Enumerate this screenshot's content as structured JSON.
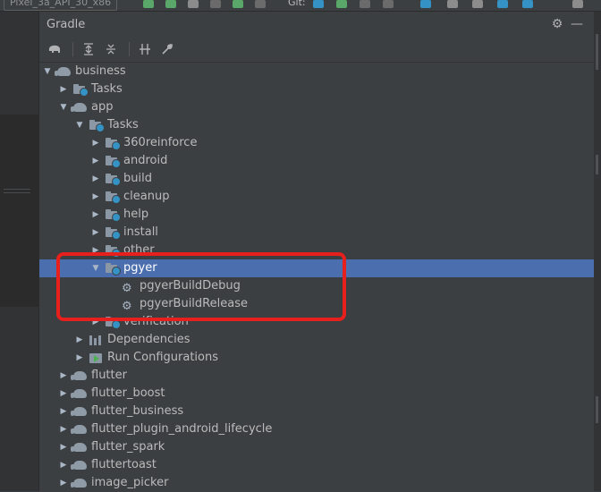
{
  "topbar": {
    "device": "Pixel_3a_API_30_x86",
    "git_label": "Git:"
  },
  "panel": {
    "title": "Gradle"
  },
  "toolbar": {
    "buttons": [
      "elephant-icon",
      "expand-all-icon",
      "collapse-all-icon",
      "toggle-offline-icon",
      "settings-wrench-icon"
    ]
  },
  "tree": [
    {
      "label": "business",
      "depth": 0,
      "expanded": true,
      "icon": "elephant"
    },
    {
      "label": "Tasks",
      "depth": 1,
      "expanded": false,
      "icon": "folder"
    },
    {
      "label": "app",
      "depth": 1,
      "expanded": true,
      "icon": "elephant"
    },
    {
      "label": "Tasks",
      "depth": 2,
      "expanded": true,
      "icon": "folder"
    },
    {
      "label": "360reinforce",
      "depth": 3,
      "expanded": false,
      "icon": "folder"
    },
    {
      "label": "android",
      "depth": 3,
      "expanded": false,
      "icon": "folder"
    },
    {
      "label": "build",
      "depth": 3,
      "expanded": false,
      "icon": "folder"
    },
    {
      "label": "cleanup",
      "depth": 3,
      "expanded": false,
      "icon": "folder"
    },
    {
      "label": "help",
      "depth": 3,
      "expanded": false,
      "icon": "folder"
    },
    {
      "label": "install",
      "depth": 3,
      "expanded": false,
      "icon": "folder"
    },
    {
      "label": "other",
      "depth": 3,
      "expanded": false,
      "icon": "folder"
    },
    {
      "label": "pgyer",
      "depth": 3,
      "expanded": true,
      "icon": "folder",
      "selected": true
    },
    {
      "label": "pgyerBuildDebug",
      "depth": 4,
      "leaf": true,
      "icon": "gear"
    },
    {
      "label": "pgyerBuildRelease",
      "depth": 4,
      "leaf": true,
      "icon": "gear"
    },
    {
      "label": "verification",
      "depth": 3,
      "expanded": false,
      "icon": "folder"
    },
    {
      "label": "Dependencies",
      "depth": 2,
      "expanded": false,
      "icon": "deps"
    },
    {
      "label": "Run Configurations",
      "depth": 2,
      "expanded": false,
      "icon": "runcfg"
    },
    {
      "label": "flutter",
      "depth": 1,
      "expanded": false,
      "icon": "elephant"
    },
    {
      "label": "flutter_boost",
      "depth": 1,
      "expanded": false,
      "icon": "elephant"
    },
    {
      "label": "flutter_business",
      "depth": 1,
      "expanded": false,
      "icon": "elephant"
    },
    {
      "label": "flutter_plugin_android_lifecycle",
      "depth": 1,
      "expanded": false,
      "icon": "elephant"
    },
    {
      "label": "flutter_spark",
      "depth": 1,
      "expanded": false,
      "icon": "elephant"
    },
    {
      "label": "fluttertoast",
      "depth": 1,
      "expanded": false,
      "icon": "elephant"
    },
    {
      "label": "image_picker",
      "depth": 1,
      "expanded": false,
      "icon": "elephant"
    }
  ],
  "colors": {
    "panel_bg": "#3c3f41",
    "selection": "#4b6eaf",
    "highlight_border": "#e8201d",
    "text": "#bbbbbb"
  }
}
